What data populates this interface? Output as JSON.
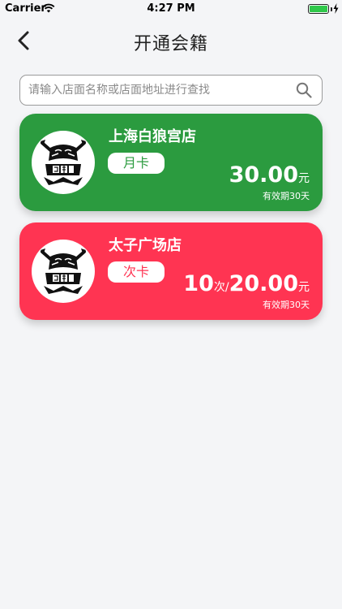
{
  "status_bar": {
    "carrier": "Carrier",
    "time": "4:27 PM"
  },
  "header": {
    "title": "开通会籍"
  },
  "search": {
    "placeholder": "请输入店面名称或店面地址进行查找"
  },
  "cards": [
    {
      "store_name": "上海白狼宫店",
      "card_type": "月卡",
      "price": "30.00",
      "currency_unit": "元",
      "validity": "有效期30天",
      "color": "#2b9b3f"
    },
    {
      "store_name": "太子广场店",
      "card_type": "次卡",
      "count": "10",
      "count_unit": "次/",
      "price": "20.00",
      "currency_unit": "元",
      "validity": "有效期30天",
      "color": "#ff3452"
    }
  ]
}
